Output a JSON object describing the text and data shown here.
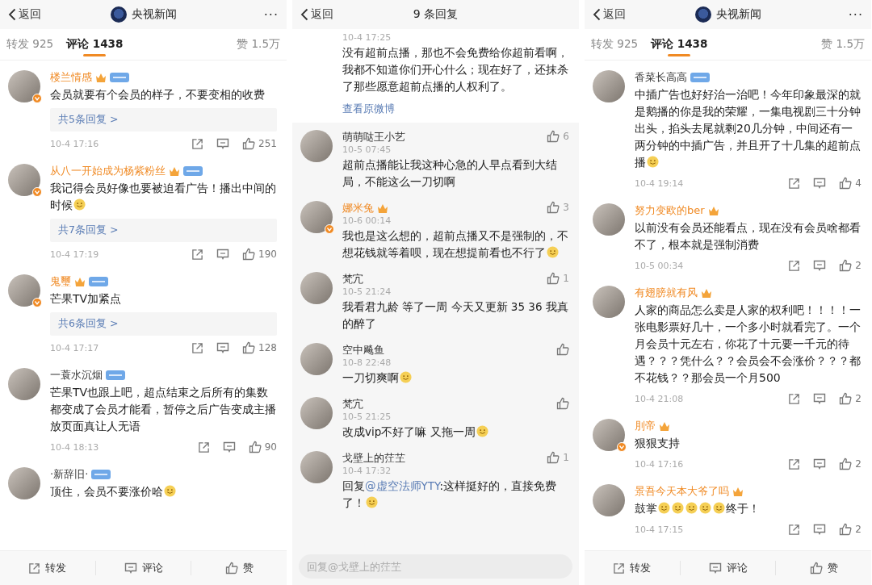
{
  "panels": [
    {
      "kind": "comments",
      "header": {
        "back": "返回",
        "title": "央视新闻",
        "more": "···"
      },
      "tabs": [
        {
          "label": "转发 925",
          "selected": false
        },
        {
          "label": "评论 1438",
          "selected": true
        }
      ],
      "likes_tab": "赞 1.5万",
      "comments": [
        {
          "name": "楼兰情感",
          "vip": true,
          "crown": true,
          "tag": true,
          "verified": true,
          "parts": [
            {
              "kind": "text",
              "text": "会员就要有个会员的样子，不要变相的收费"
            }
          ],
          "replies": "共5条回复 >",
          "time": "10-4 17:16",
          "likes": "251"
        },
        {
          "name": "从八一开始成为杨紫粉丝",
          "vip": true,
          "crown": true,
          "tag": true,
          "verified": true,
          "parts": [
            {
              "kind": "text",
              "text": "我记得会员好像也要被迫看广告！播出中间的时候"
            },
            {
              "kind": "emoji"
            }
          ],
          "replies": "共7条回复 >",
          "time": "10-4 17:19",
          "likes": "190"
        },
        {
          "name": "鬼璽",
          "vip": true,
          "crown": true,
          "tag": true,
          "verified": true,
          "parts": [
            {
              "kind": "text",
              "text": "芒果TV加紧点"
            }
          ],
          "replies": "共6条回复 >",
          "time": "10-4 17:17",
          "likes": "128"
        },
        {
          "name": "一蓑水沉烟",
          "vip": false,
          "crown": false,
          "tag": true,
          "verified": false,
          "parts": [
            {
              "kind": "text",
              "text": "芒果TV也跟上吧，超点结束之后所有的集数都变成了会员才能看，暂停之后广告变成主播放页面真让人无语"
            }
          ],
          "time": "10-4 18:13",
          "likes": "90"
        },
        {
          "name": "·新辞旧·",
          "vip": false,
          "crown": false,
          "tag": true,
          "verified": false,
          "parts": [
            {
              "kind": "text",
              "text": "顶住，会员不要涨价哈"
            },
            {
              "kind": "emoji"
            }
          ]
        }
      ],
      "bottom_bar": [
        "转发",
        "评论",
        "赞"
      ]
    },
    {
      "kind": "replies",
      "header": {
        "back": "返回",
        "title": "9 条回复"
      },
      "post": {
        "time": "10-4 17:25",
        "text": "没有超前点播，那也不会免费给你超前看啊，我都不知道你们开心什么；现在好了，还抹杀了那些愿意超前点播的人权利了。",
        "link": "查看原微博"
      },
      "replies": [
        {
          "name": "萌萌哒王小艺",
          "vip": false,
          "crown": false,
          "verified": false,
          "time": "10-5 07:45",
          "likes": "6",
          "parts": [
            {
              "kind": "text",
              "text": "超前点播能让我这种心急的人早点看到大结局，不能这么一刀切啊"
            }
          ]
        },
        {
          "name": "娜米兔",
          "vip": true,
          "crown": true,
          "verified": true,
          "time": "10-6 00:14",
          "likes": "3",
          "parts": [
            {
              "kind": "text",
              "text": "我也是这么想的，超前点播又不是强制的，不想花钱就等着呗，现在想提前看也不行了"
            },
            {
              "kind": "emoji"
            }
          ]
        },
        {
          "name": "梵宂",
          "vip": false,
          "crown": false,
          "verified": false,
          "time": "10-5 21:24",
          "likes": "1",
          "parts": [
            {
              "kind": "text",
              "text": "我看君九龄  等了一周 今天又更新 35 36 我真的醉了"
            }
          ]
        },
        {
          "name": "空中飚鱼",
          "vip": false,
          "crown": false,
          "verified": false,
          "time": "10-8 22:48",
          "parts": [
            {
              "kind": "text",
              "text": "一刀切爽啊"
            },
            {
              "kind": "emoji"
            }
          ]
        },
        {
          "name": "梵宂",
          "vip": false,
          "crown": false,
          "verified": false,
          "time": "10-5 21:25",
          "parts": [
            {
              "kind": "text",
              "text": "改成vip不好了嘛  又拖一周"
            },
            {
              "kind": "emoji"
            }
          ]
        },
        {
          "name": "戈壁上的茳芏",
          "vip": false,
          "crown": false,
          "verified": false,
          "time": "10-4 17:32",
          "likes": "1",
          "parts": [
            {
              "kind": "text",
              "text": "回复"
            },
            {
              "kind": "mention",
              "text": "@虚空法师YTY"
            },
            {
              "kind": "text",
              "text": ":这样挺好的，直接免费了！"
            },
            {
              "kind": "emoji"
            }
          ]
        }
      ],
      "reply_field": {
        "placeholder": "回复@戈壁上的茳芏"
      }
    },
    {
      "kind": "comments",
      "header": {
        "back": "返回",
        "title": "央视新闻",
        "more": "···"
      },
      "tabs": [
        {
          "label": "转发 925",
          "selected": false
        },
        {
          "label": "评论 1438",
          "selected": true
        }
      ],
      "likes_tab": "赞 1.5万",
      "comments": [
        {
          "name": "香菜长高高",
          "vip": false,
          "crown": false,
          "tag": true,
          "verified": false,
          "parts": [
            {
              "kind": "text",
              "text": "中插广告也好好治一治吧！今年印象最深的就是鹅播的你是我的荣耀，一集电视剧三十分钟出头，掐头去尾就剩20几分钟，中间还有一两分钟的中插广告，并且开了十几集的超前点播"
            },
            {
              "kind": "emoji"
            }
          ],
          "time": "10-4 19:14",
          "likes": "4"
        },
        {
          "name": "努力变欧的ber",
          "vip": true,
          "crown": true,
          "tag": false,
          "verified": false,
          "parts": [
            {
              "kind": "text",
              "text": "以前没有会员还能看点，现在没有会员啥都看不了，根本就是强制消费"
            }
          ],
          "time": "10-5 00:34",
          "likes": "2"
        },
        {
          "name": "有翅膀就有风",
          "vip": true,
          "crown": true,
          "tag": false,
          "verified": false,
          "parts": [
            {
              "kind": "text",
              "text": "人家的商品怎么卖是人家的权利吧！！！！一张电影票好几十，一个多小时就看完了。一个月会员十元左右，你花了十元要一千元的待遇？？？凭什么？？会员会不会涨价？？？都不花钱？？那会员一个月500"
            }
          ],
          "time": "10-4 21:08",
          "likes": "2"
        },
        {
          "name": "刖帝",
          "vip": true,
          "crown": true,
          "tag": false,
          "verified": true,
          "parts": [
            {
              "kind": "text",
              "text": "狠狠支持"
            }
          ],
          "time": "10-4 17:16",
          "likes": "2"
        },
        {
          "name": "景吾今天本大爷了吗",
          "vip": true,
          "crown": true,
          "tag": false,
          "verified": false,
          "parts": [
            {
              "kind": "text",
              "text": "鼓掌"
            },
            {
              "kind": "emoji"
            },
            {
              "kind": "emoji"
            },
            {
              "kind": "emoji"
            },
            {
              "kind": "emoji"
            },
            {
              "kind": "emoji"
            },
            {
              "kind": "text",
              "text": "终于！"
            }
          ],
          "time": "10-4 17:15",
          "likes": "2"
        }
      ],
      "bottom_bar": [
        "转发",
        "评论",
        "赞"
      ]
    }
  ]
}
